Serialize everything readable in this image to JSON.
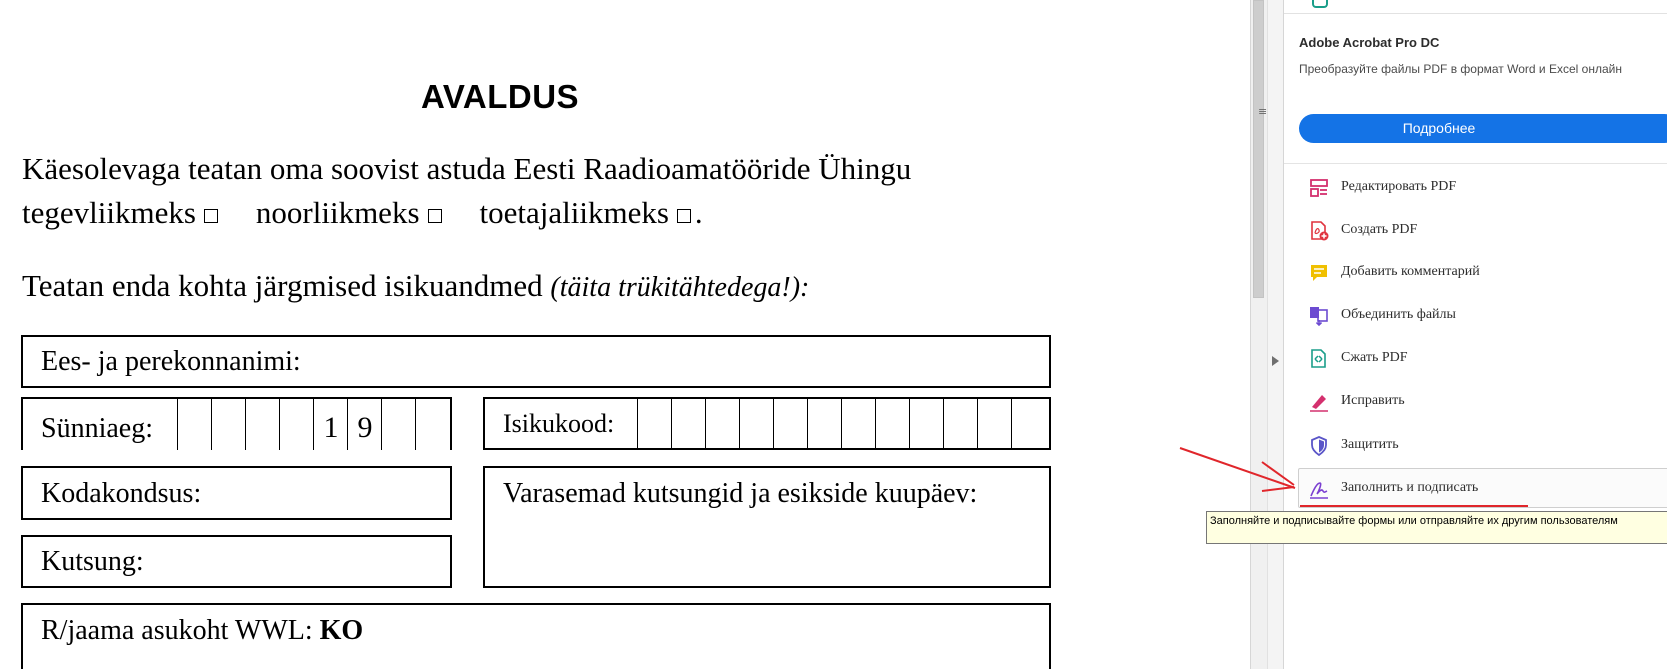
{
  "document": {
    "title": "AVALDUS",
    "line1": "Käesolevaga teatan oma soovist astuda Eesti Raadioamatööride Ühingu",
    "member_options": [
      "tegevliikmeks",
      "noorliikmeks",
      "toetajaliikmeks"
    ],
    "line2_end": ".",
    "line3_main": "Teatan enda kohta järgmised isikuandmed",
    "line3_note": "(täita trükitähtedega!):",
    "fields": {
      "name": "Ees- ja perekonnanimi:",
      "birthdate": "Sünniaeg:",
      "birth_digit_1": "1",
      "birth_digit_2": "9",
      "id_code": "Isikukood:",
      "citizenship": "Kodakondsus:",
      "previous_callsigns": "Varasemad kutsungid ja esikside kuupäev:",
      "callsign": "Kutsung:",
      "location_label": "R/jaama asukoht WWL:",
      "location_value": "KO"
    }
  },
  "promo": {
    "title": "Adobe Acrobat Pro DC",
    "description": "Преобразуйте файлы PDF в формат Word и Excel онлайн",
    "button": "Подробнее"
  },
  "tools": [
    {
      "label": "Редактировать PDF",
      "icon": "edit-pdf-icon",
      "color": "#d4306e"
    },
    {
      "label": "Создать PDF",
      "icon": "create-pdf-icon",
      "color": "#e0343f"
    },
    {
      "label": "Добавить комментарий",
      "icon": "comment-icon",
      "color": "#e6b100"
    },
    {
      "label": "Объединить файлы",
      "icon": "combine-files-icon",
      "color": "#6c4bd1"
    },
    {
      "label": "Сжать PDF",
      "icon": "compress-pdf-icon",
      "color": "#1a9e8a"
    },
    {
      "label": "Исправить",
      "icon": "redact-icon",
      "color": "#d4306e"
    },
    {
      "label": "Защитить",
      "icon": "protect-icon",
      "color": "#5a55c8"
    },
    {
      "label": "Заполнить и подписать",
      "icon": "fill-sign-icon",
      "color": "#7b3fd1"
    }
  ],
  "tooltip": "Заполняйте и подписывайте формы или отправляйте их другим пользователям",
  "colors": {
    "accent": "#1473e6",
    "annotation": "#e0262b",
    "tooltip_bg": "#ffffe1"
  }
}
